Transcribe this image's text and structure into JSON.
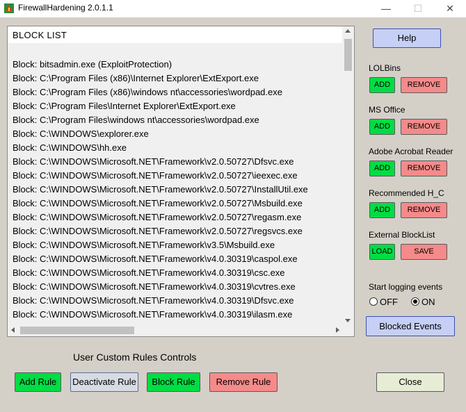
{
  "window": {
    "title": "FirewallHardening 2.0.1.1",
    "minimize_glyph": "—",
    "maximize_glyph": "☐",
    "close_glyph": "✕"
  },
  "list": {
    "header": "BLOCK  LIST",
    "items": [
      "Block: bitsadmin.exe (ExploitProtection)",
      "Block: C:\\Program Files (x86)\\Internet Explorer\\ExtExport.exe",
      "Block: C:\\Program Files (x86)\\windows nt\\accessories\\wordpad.exe",
      "Block: C:\\Program Files\\Internet Explorer\\ExtExport.exe",
      "Block: C:\\Program Files\\windows nt\\accessories\\wordpad.exe",
      "Block: C:\\WINDOWS\\explorer.exe",
      "Block: C:\\WINDOWS\\hh.exe",
      "Block: C:\\WINDOWS\\Microsoft.NET\\Framework\\v2.0.50727\\Dfsvc.exe",
      "Block: C:\\WINDOWS\\Microsoft.NET\\Framework\\v2.0.50727\\ieexec.exe",
      "Block: C:\\WINDOWS\\Microsoft.NET\\Framework\\v2.0.50727\\InstallUtil.exe",
      "Block: C:\\WINDOWS\\Microsoft.NET\\Framework\\v2.0.50727\\Msbuild.exe",
      "Block: C:\\WINDOWS\\Microsoft.NET\\Framework\\v2.0.50727\\regasm.exe",
      "Block: C:\\WINDOWS\\Microsoft.NET\\Framework\\v2.0.50727\\regsvcs.exe",
      "Block: C:\\WINDOWS\\Microsoft.NET\\Framework\\v3.5\\Msbuild.exe",
      "Block: C:\\WINDOWS\\Microsoft.NET\\Framework\\v4.0.30319\\caspol.exe",
      "Block: C:\\WINDOWS\\Microsoft.NET\\Framework\\v4.0.30319\\csc.exe",
      "Block: C:\\WINDOWS\\Microsoft.NET\\Framework\\v4.0.30319\\cvtres.exe",
      "Block: C:\\WINDOWS\\Microsoft.NET\\Framework\\v4.0.30319\\Dfsvc.exe",
      "Block: C:\\WINDOWS\\Microsoft.NET\\Framework\\v4.0.30319\\ilasm.exe"
    ]
  },
  "sidepanel": {
    "help_label": "Help",
    "sections": [
      {
        "label": "LOLBins",
        "left": "ADD",
        "right": "REMOVE"
      },
      {
        "label": "MS Office",
        "left": "ADD",
        "right": "REMOVE"
      },
      {
        "label": "Adobe Acrobat Reader",
        "left": "ADD",
        "right": "REMOVE"
      },
      {
        "label": "Recommended H_C",
        "left": "ADD",
        "right": "REMOVE"
      },
      {
        "label": "External BlockList",
        "left": "LOAD",
        "right": "SAVE"
      }
    ],
    "logging_label": "Start logging events",
    "radio_off_label": "OFF",
    "radio_on_label": "ON",
    "logging_state": "ON",
    "blocked_events_label": "Blocked Events"
  },
  "footer": {
    "section_label": "User Custom Rules Controls",
    "add_rule": "Add Rule",
    "deactivate_rule": "Deactivate Rule",
    "block_rule": "Block Rule",
    "remove_rule": "Remove Rule",
    "close": "Close"
  },
  "colors": {
    "green": "#00dd44",
    "red": "#f58a8a",
    "blue": "#c6cff5",
    "background": "#d4d0c8"
  }
}
